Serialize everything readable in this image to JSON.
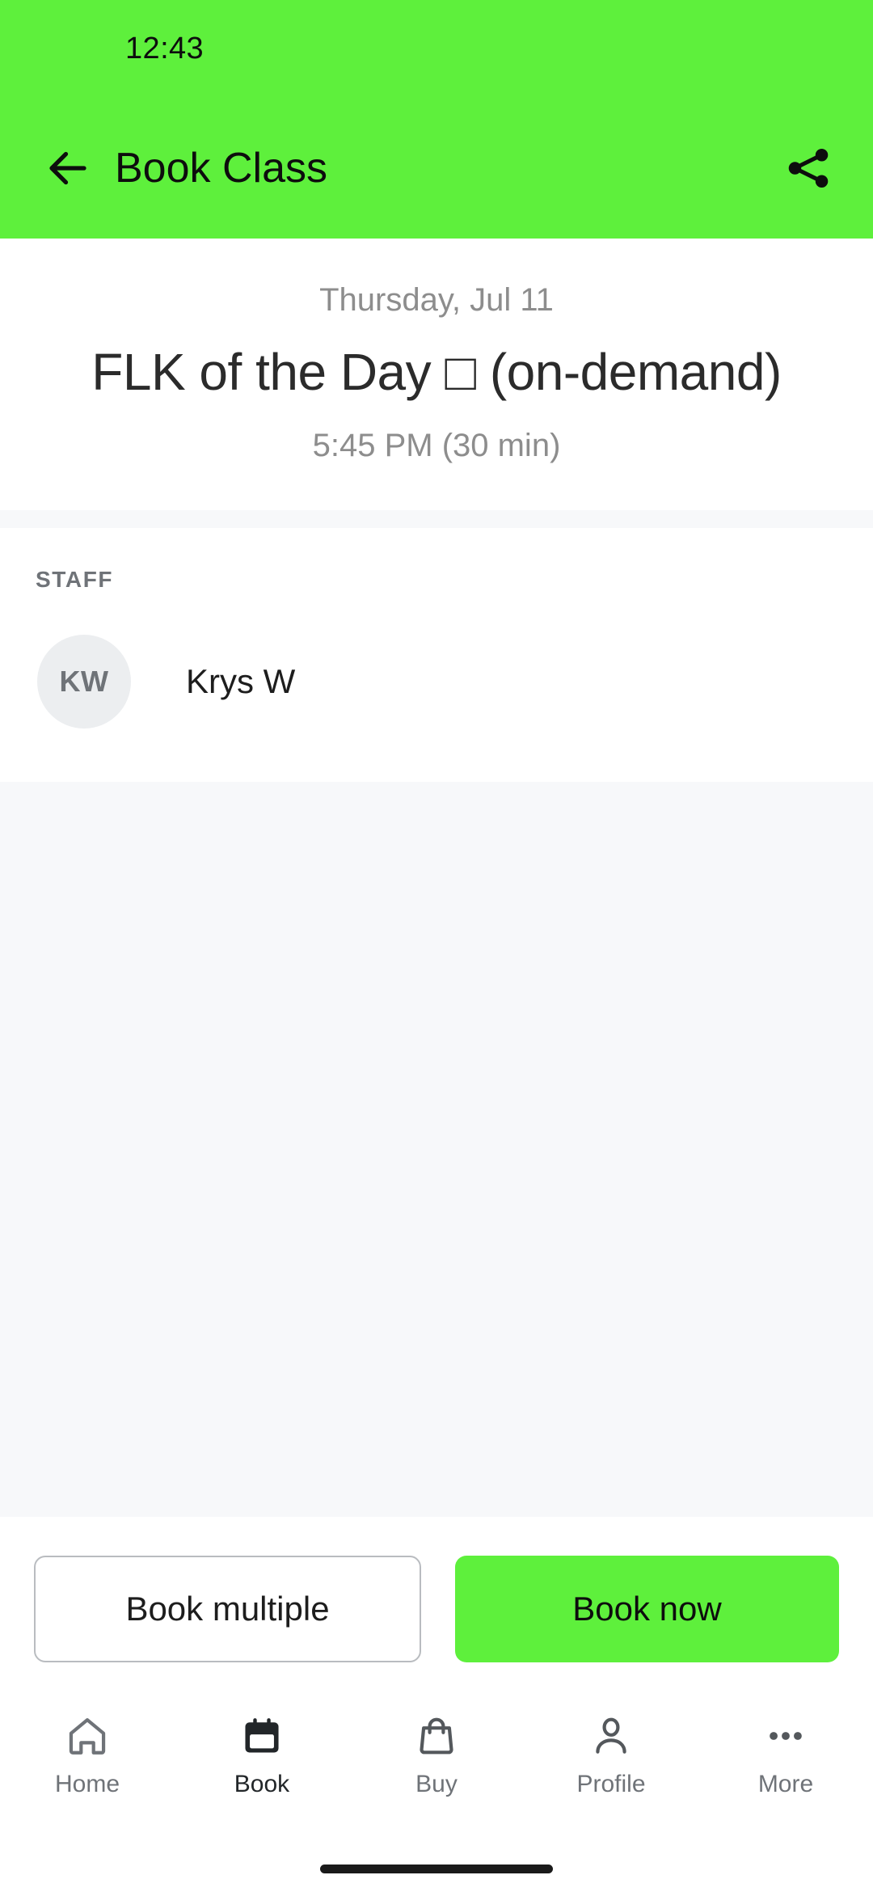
{
  "theme": {
    "accent": "#5EF03C",
    "surface": "#FFFFFF",
    "muted_surface": "#F7F8FA",
    "text_primary": "#1D1D1D",
    "text_muted": "#8D8D8D",
    "label_muted": "#6F7378",
    "outline": "#B9BCC0"
  },
  "status_bar": {
    "time": "12:43"
  },
  "app_bar": {
    "back_icon": "arrow-left-icon",
    "title": "Book Class",
    "share_icon": "share-icon"
  },
  "class_summary": {
    "date": "Thursday, Jul 11",
    "title": "FLK of the Day □ (on-demand)",
    "time": "5:45 PM (30 min)"
  },
  "staff_section": {
    "label": "STAFF",
    "members": [
      {
        "initials": "KW",
        "name": "Krys W"
      }
    ]
  },
  "actions": {
    "secondary_label": "Book multiple",
    "primary_label": "Book now"
  },
  "bottom_nav": {
    "items": [
      {
        "label": "Home",
        "icon": "home-icon",
        "active": false
      },
      {
        "label": "Book",
        "icon": "calendar-icon",
        "active": true
      },
      {
        "label": "Buy",
        "icon": "bag-icon",
        "active": false
      },
      {
        "label": "Profile",
        "icon": "person-icon",
        "active": false
      },
      {
        "label": "More",
        "icon": "ellipsis-icon",
        "active": false
      }
    ]
  }
}
